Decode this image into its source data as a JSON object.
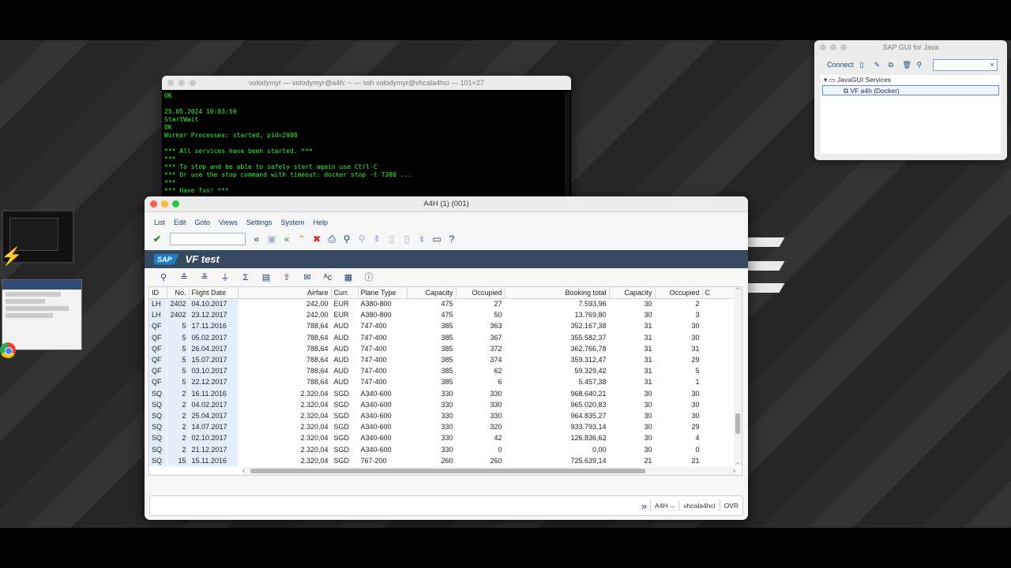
{
  "terminal": {
    "title": "volodymyr — volodymyr@a4h: ~ — ssh volodymyr@vhcala4hci — 101×27",
    "lines": [
      "OK",
      "",
      "25.05.2024 10:03:59",
      "StartWait",
      "OK",
      "Worker Processes: started, pid=2908",
      "",
      "*** All services have been started. ***",
      "***",
      "*** To stop and be able to safely start again use Ctrl-C",
      "*** Or use the stop command with timeout: docker stop -t 7200 ...",
      "***",
      "*** Have fun! ***"
    ]
  },
  "sap_java": {
    "title": "SAP GUI for Java",
    "connect_label": "Connect",
    "search_clear": "×",
    "tree_root": "JavaGUI Services",
    "tree_item": "VF a4h (Docker)"
  },
  "sap_window": {
    "title": "A4H (1) (001)",
    "menu": [
      "List",
      "Edit",
      "Goto",
      "Views",
      "Settings",
      "System",
      "Help"
    ],
    "header_logo": "SAP",
    "header_title": "VF test",
    "columns": [
      "ID",
      "No.",
      "Flight Date",
      "Airfare",
      "Curr.",
      "Plane Type",
      "Capacity",
      "Occupied",
      "Booking total",
      "Capacity",
      "Occupied",
      "C"
    ],
    "rows": [
      [
        "LH",
        "2402",
        "04.10.2017",
        "242,00",
        "EUR",
        "A380-800",
        "475",
        "27",
        "7.593,96",
        "30",
        "2",
        ""
      ],
      [
        "LH",
        "2402",
        "23.12.2017",
        "242,00",
        "EUR",
        "A380-800",
        "475",
        "50",
        "13.769,80",
        "30",
        "3",
        ""
      ],
      [
        "QF",
        "5",
        "17.11.2016",
        "788,64",
        "AUD",
        "747-400",
        "385",
        "363",
        "352.167,38",
        "31",
        "30",
        ""
      ],
      [
        "QF",
        "5",
        "05.02.2017",
        "788,64",
        "AUD",
        "747-400",
        "385",
        "367",
        "355.582,37",
        "31",
        "30",
        ""
      ],
      [
        "QF",
        "5",
        "26.04.2017",
        "788,64",
        "AUD",
        "747-400",
        "385",
        "372",
        "362.766,78",
        "31",
        "31",
        ""
      ],
      [
        "QF",
        "5",
        "15.07.2017",
        "788,64",
        "AUD",
        "747-400",
        "385",
        "374",
        "359.312,47",
        "31",
        "29",
        ""
      ],
      [
        "QF",
        "5",
        "03.10.2017",
        "788,64",
        "AUD",
        "747-400",
        "385",
        "62",
        "59.329,42",
        "31",
        "5",
        ""
      ],
      [
        "QF",
        "5",
        "22.12.2017",
        "788,64",
        "AUD",
        "747-400",
        "385",
        "6",
        "5.457,38",
        "31",
        "1",
        ""
      ],
      [
        "SQ",
        "2",
        "16.11.2016",
        "2.320,04",
        "SGD",
        "A340-600",
        "330",
        "330",
        "968.640,21",
        "30",
        "30",
        ""
      ],
      [
        "SQ",
        "2",
        "04.02.2017",
        "2.320,04",
        "SGD",
        "A340-600",
        "330",
        "330",
        "965.020,83",
        "30",
        "30",
        ""
      ],
      [
        "SQ",
        "2",
        "25.04.2017",
        "2.320,04",
        "SGD",
        "A340-600",
        "330",
        "330",
        "964.835,27",
        "30",
        "30",
        ""
      ],
      [
        "SQ",
        "2",
        "14.07.2017",
        "2.320,04",
        "SGD",
        "A340-600",
        "330",
        "320",
        "933.793,14",
        "30",
        "29",
        ""
      ],
      [
        "SQ",
        "2",
        "02.10.2017",
        "2.320,04",
        "SGD",
        "A340-600",
        "330",
        "42",
        "126.836,62",
        "30",
        "4",
        ""
      ],
      [
        "SQ",
        "2",
        "21.12.2017",
        "2.320,04",
        "SGD",
        "A340-600",
        "330",
        "0",
        "0,00",
        "30",
        "0",
        ""
      ],
      [
        "SQ",
        "15",
        "15.11.2016",
        "2.320,04",
        "SGD",
        "767-200",
        "260",
        "260",
        "725.639,14",
        "21",
        "21",
        ""
      ]
    ],
    "status": {
      "system": "A4H",
      "host": "vhcala4hci",
      "mode": "OVR"
    }
  },
  "colors": {
    "terminal_text": "#38f43a",
    "sap_header": "#354a5f",
    "key_cell": "#e3eefb"
  }
}
